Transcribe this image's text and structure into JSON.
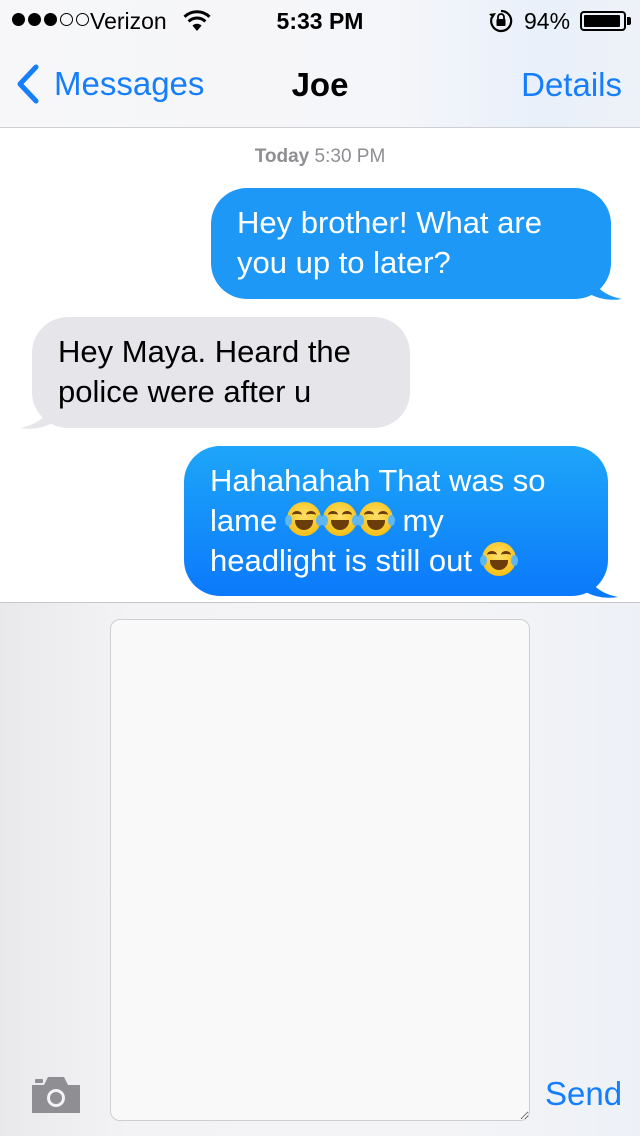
{
  "status_bar": {
    "signal_bars_filled": 3,
    "signal_bars_total": 5,
    "carrier": "Verizon",
    "time": "5:33 PM",
    "battery_percent": "94%",
    "battery_level": 0.94
  },
  "nav": {
    "back_label": "Messages",
    "title": "Joe",
    "details_label": "Details"
  },
  "conversation": {
    "timestamp_day": "Today",
    "timestamp_time": "5:30 PM",
    "messages": [
      {
        "direction": "outgoing",
        "text_line1": "Hey brother! What are",
        "text_line2": "you up to later?"
      },
      {
        "direction": "incoming",
        "text_line1": "Hey Maya. Heard the",
        "text_line2": "police were after u"
      },
      {
        "direction": "outgoing",
        "text_line1": "Hahahahah That was so",
        "text_line2_a": "lame",
        "text_line2_b": "my",
        "text_line3": "headlight is still out",
        "emoji": "face-with-tears-of-joy"
      }
    ]
  },
  "compose": {
    "input_value": "",
    "send_label": "Send",
    "camera_icon": "camera-icon"
  },
  "colors": {
    "accent": "#157efb",
    "bubble_outgoing": "#0b79fb",
    "bubble_incoming": "#e5e5ea"
  }
}
